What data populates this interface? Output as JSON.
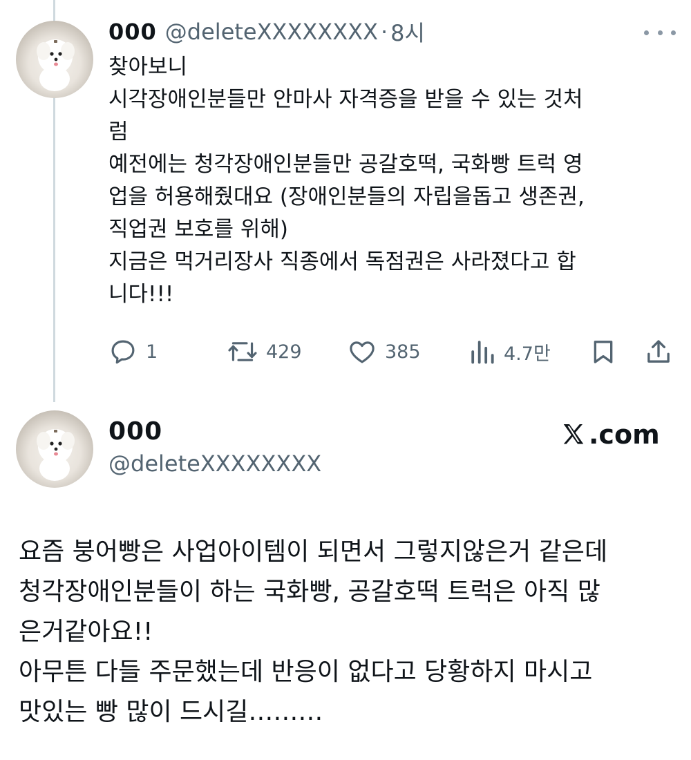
{
  "tweet1": {
    "display_name": "000",
    "handle": "@deleteXXXXXXXX",
    "separator": "·",
    "time": "8시",
    "body_lines": [
      "찾아보니",
      "시각장애인분들만 안마사 자격증을 받을 수 있는 것처",
      "럼",
      "예전에는 청각장애인분들만 공갈호떡, 국화빵 트럭 영",
      "업을 허용해줬대요 (장애인분들의 자립을돕고 생존권,",
      "직업권 보호를 위해)",
      "지금은 먹거리장사 직종에서 독점권은 사라졌다고 합",
      "니다!!!"
    ],
    "actions": {
      "reply_count": "1",
      "retweet_count": "429",
      "like_count": "385",
      "view_count": "4.7만"
    }
  },
  "tweet2": {
    "display_name": "000",
    "handle": "@deleteXXXXXXXX",
    "watermark": ".com",
    "body_lines": [
      "요즘 붕어빵은 사업아이템이 되면서 그렇지않은거 같은데",
      "청각장애인분들이 하는 국화빵, 공갈호떡 트럭은 아직 많",
      "은거같아요!!",
      "아무튼 다들 주문했는데 반응이 없다고 당황하지 마시고",
      "맛있는 빵 많이 드시길………"
    ]
  },
  "colors": {
    "text": "#0f1419",
    "secondary": "#536471",
    "thread_line": "#cfd9de"
  },
  "icons": [
    "more-icon",
    "reply-icon",
    "retweet-icon",
    "like-icon",
    "views-icon",
    "bookmark-icon",
    "share-icon",
    "x-logo-icon"
  ]
}
